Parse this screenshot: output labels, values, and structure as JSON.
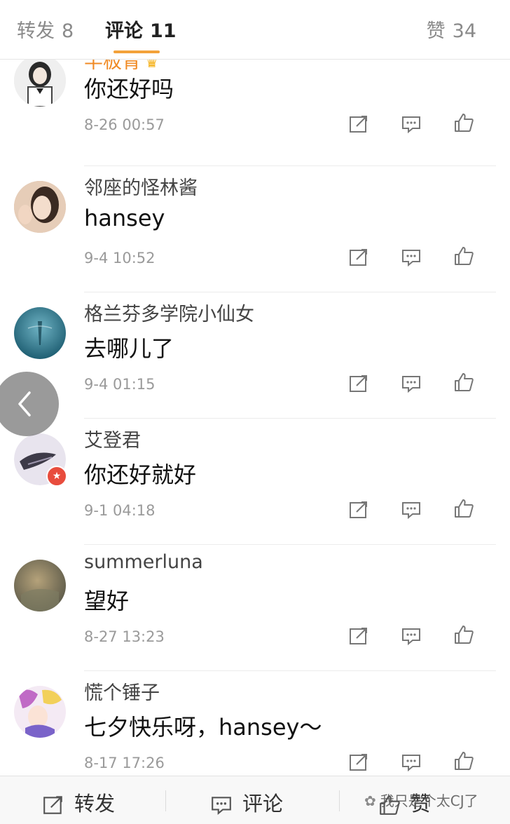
{
  "tabs": {
    "repost": {
      "label": "转发",
      "count": "8"
    },
    "comment": {
      "label": "评论",
      "count": "11"
    },
    "like": {
      "label": "赞",
      "count": "34"
    }
  },
  "comments": [
    {
      "name": "半板青",
      "text": "你还好吗",
      "time": "8-26 00:57"
    },
    {
      "name": "邻座的怪林酱",
      "text": "hansey",
      "time": "9-4 10:52"
    },
    {
      "name": "格兰芬多学院小仙女",
      "text": "去哪儿了",
      "time": "9-4 01:15"
    },
    {
      "name": "艾登君",
      "text": "你还好就好",
      "time": "9-1 04:18"
    },
    {
      "name": "summerluna",
      "text": "望好",
      "time": "8-27 13:23"
    },
    {
      "name": "慌个锤子",
      "text": "七夕快乐呀，hansey～",
      "time": "8-17 17:26"
    }
  ],
  "bottom_bar": {
    "repost_label": "转发",
    "comment_label": "评论",
    "like_label": "赞"
  },
  "watermark": "我只是个太CJ了",
  "colors": {
    "accent": "#f3a23a",
    "vip_name": "#f08a24"
  }
}
